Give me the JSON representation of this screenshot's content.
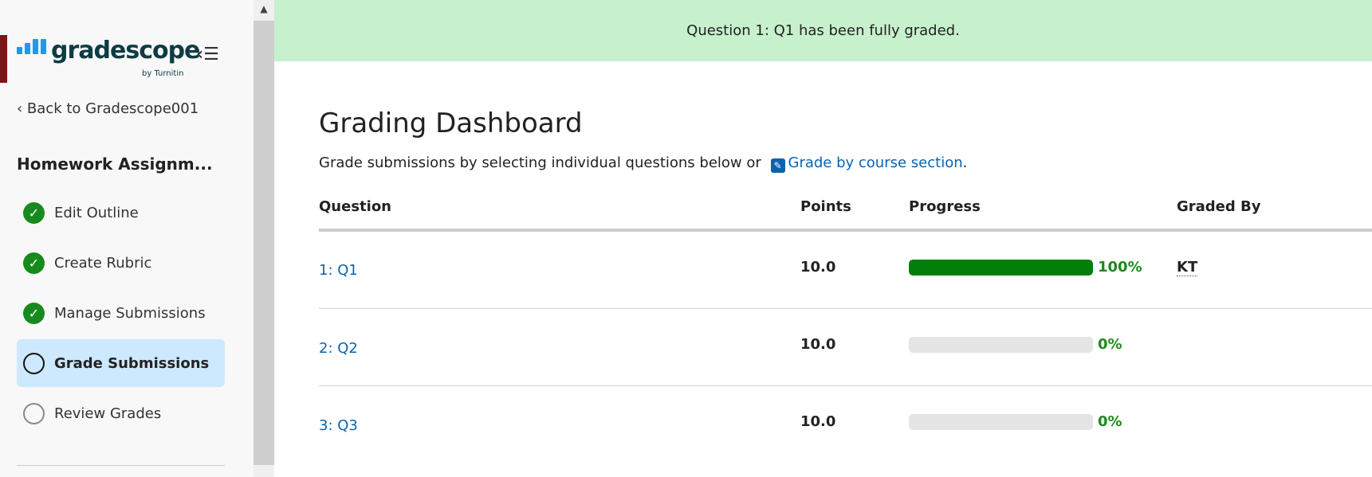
{
  "sidebar": {
    "logo_text": "gradescope",
    "logo_byline": "by Turnitin",
    "back_link": "Back to Gradescope001",
    "assignment_title": "Homework Assignm...",
    "items": [
      {
        "label": "Edit Outline",
        "status": "done"
      },
      {
        "label": "Create Rubric",
        "status": "done"
      },
      {
        "label": "Manage Submissions",
        "status": "done"
      },
      {
        "label": "Grade Submissions",
        "status": "current"
      },
      {
        "label": "Review Grades",
        "status": "todo"
      }
    ]
  },
  "banner": {
    "message": "Question 1: Q1 has been fully graded."
  },
  "main": {
    "title": "Grading Dashboard",
    "subtitle_prefix": "Grade submissions by selecting individual questions below or ",
    "subtitle_link": "Grade by course section",
    "subtitle_suffix": ".",
    "columns": [
      "Question",
      "Points",
      "Progress",
      "Graded By"
    ],
    "rows": [
      {
        "question": "1: Q1",
        "points": "10.0",
        "progress": 100,
        "progress_label": "100%",
        "graded_by": "KT"
      },
      {
        "question": "2: Q2",
        "points": "10.0",
        "progress": 0,
        "progress_label": "0%",
        "graded_by": ""
      },
      {
        "question": "3: Q3",
        "points": "10.0",
        "progress": 0,
        "progress_label": "0%",
        "graded_by": ""
      }
    ]
  },
  "colors": {
    "banner": "#c7f0cd",
    "progress_fill": "#047e0b",
    "link": "#0a63b0",
    "active_nav": "#cde9fd"
  }
}
